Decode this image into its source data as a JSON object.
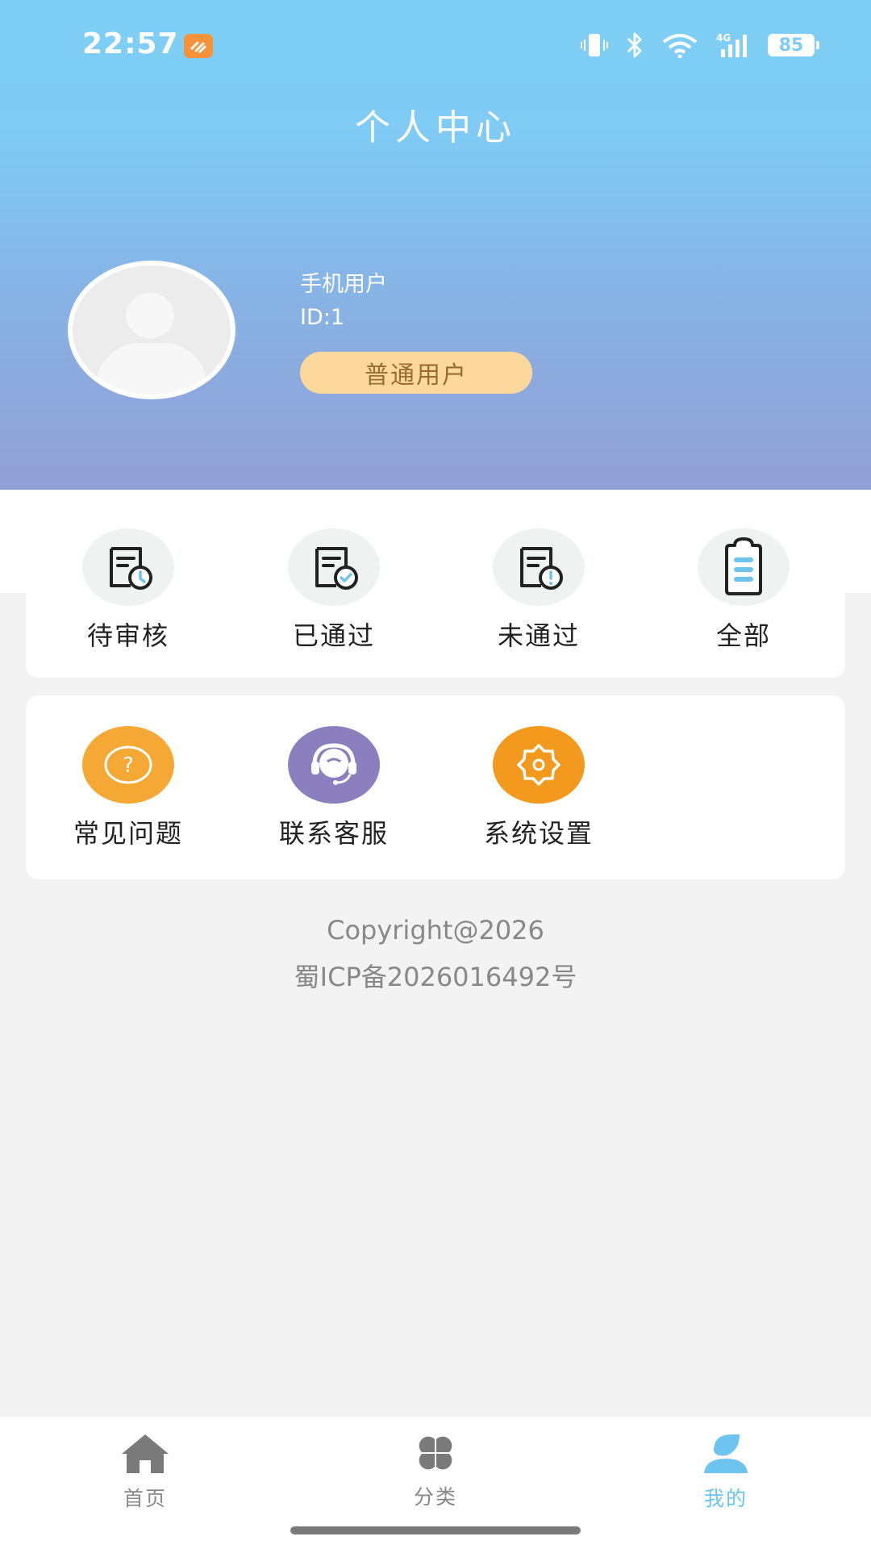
{
  "status_bar": {
    "time": "22:57",
    "battery": "85",
    "network": "4G"
  },
  "header": {
    "title": "个人中心"
  },
  "profile": {
    "name": "手机用户",
    "id": "ID:1",
    "badge": "普通用户"
  },
  "orders": [
    {
      "label": "待审核",
      "icon": "document-clock-icon"
    },
    {
      "label": "已通过",
      "icon": "document-check-icon"
    },
    {
      "label": "未通过",
      "icon": "document-alert-icon"
    },
    {
      "label": "全部",
      "icon": "clipboard-list-icon"
    }
  ],
  "services": [
    {
      "label": "常见问题",
      "icon": "question-icon",
      "color": "#f5a833"
    },
    {
      "label": "联系客服",
      "icon": "headset-icon",
      "color": "#8c7fbf"
    },
    {
      "label": "系统设置",
      "icon": "gear-icon",
      "color": "#f39a1e"
    }
  ],
  "footer": {
    "copyright": "Copyright@2026",
    "icp": "蜀ICP备2026016492号"
  },
  "tabbar": {
    "items": [
      {
        "label": "首页",
        "icon": "home-icon"
      },
      {
        "label": "分类",
        "icon": "category-icon"
      },
      {
        "label": "我的",
        "icon": "user-icon",
        "active": true
      }
    ]
  },
  "colors": {
    "accent": "#6cc4ef",
    "badge_bg": "#fcd89d",
    "badge_text": "#9c6a33"
  }
}
